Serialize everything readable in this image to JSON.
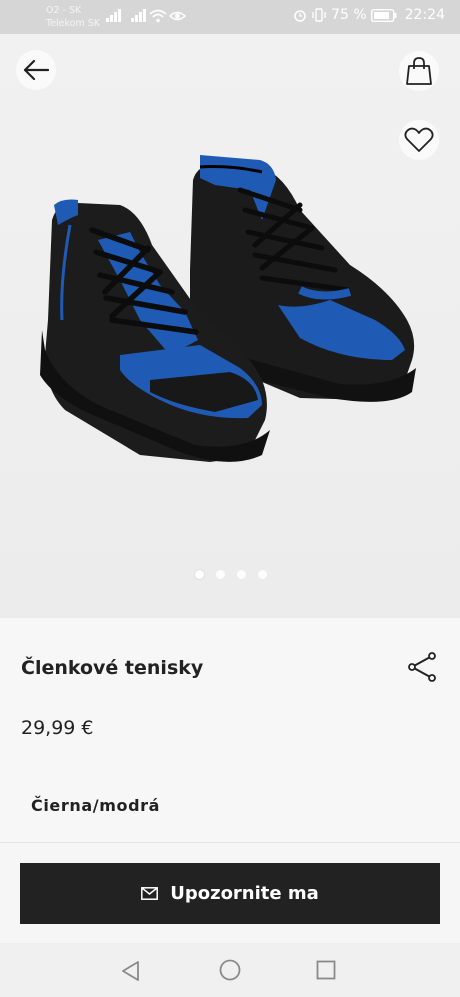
{
  "status_bar": {
    "carrier_line1": "O2 - SK",
    "carrier_line2": "Telekom SK",
    "battery_text": "75 %",
    "time": "22:24"
  },
  "header": {
    "back_icon": "arrow-left-icon",
    "bag_icon": "shopping-bag-icon",
    "favorite_icon": "heart-icon"
  },
  "gallery": {
    "dot_count": 4,
    "active_index": 0
  },
  "product": {
    "title": "Členkové tenisky",
    "price": "29,99 €",
    "color_name": "Čierna/modrá"
  },
  "actions": {
    "share_icon": "share-icon",
    "notify_icon": "envelope-icon",
    "notify_label": "Upozornite ma"
  },
  "nav": {
    "back_icon": "triangle-back-icon",
    "home_icon": "circle-home-icon",
    "recents_icon": "square-recents-icon"
  },
  "colors": {
    "button_bg": "#222222",
    "shoe_accent": "#1f5bb5"
  }
}
